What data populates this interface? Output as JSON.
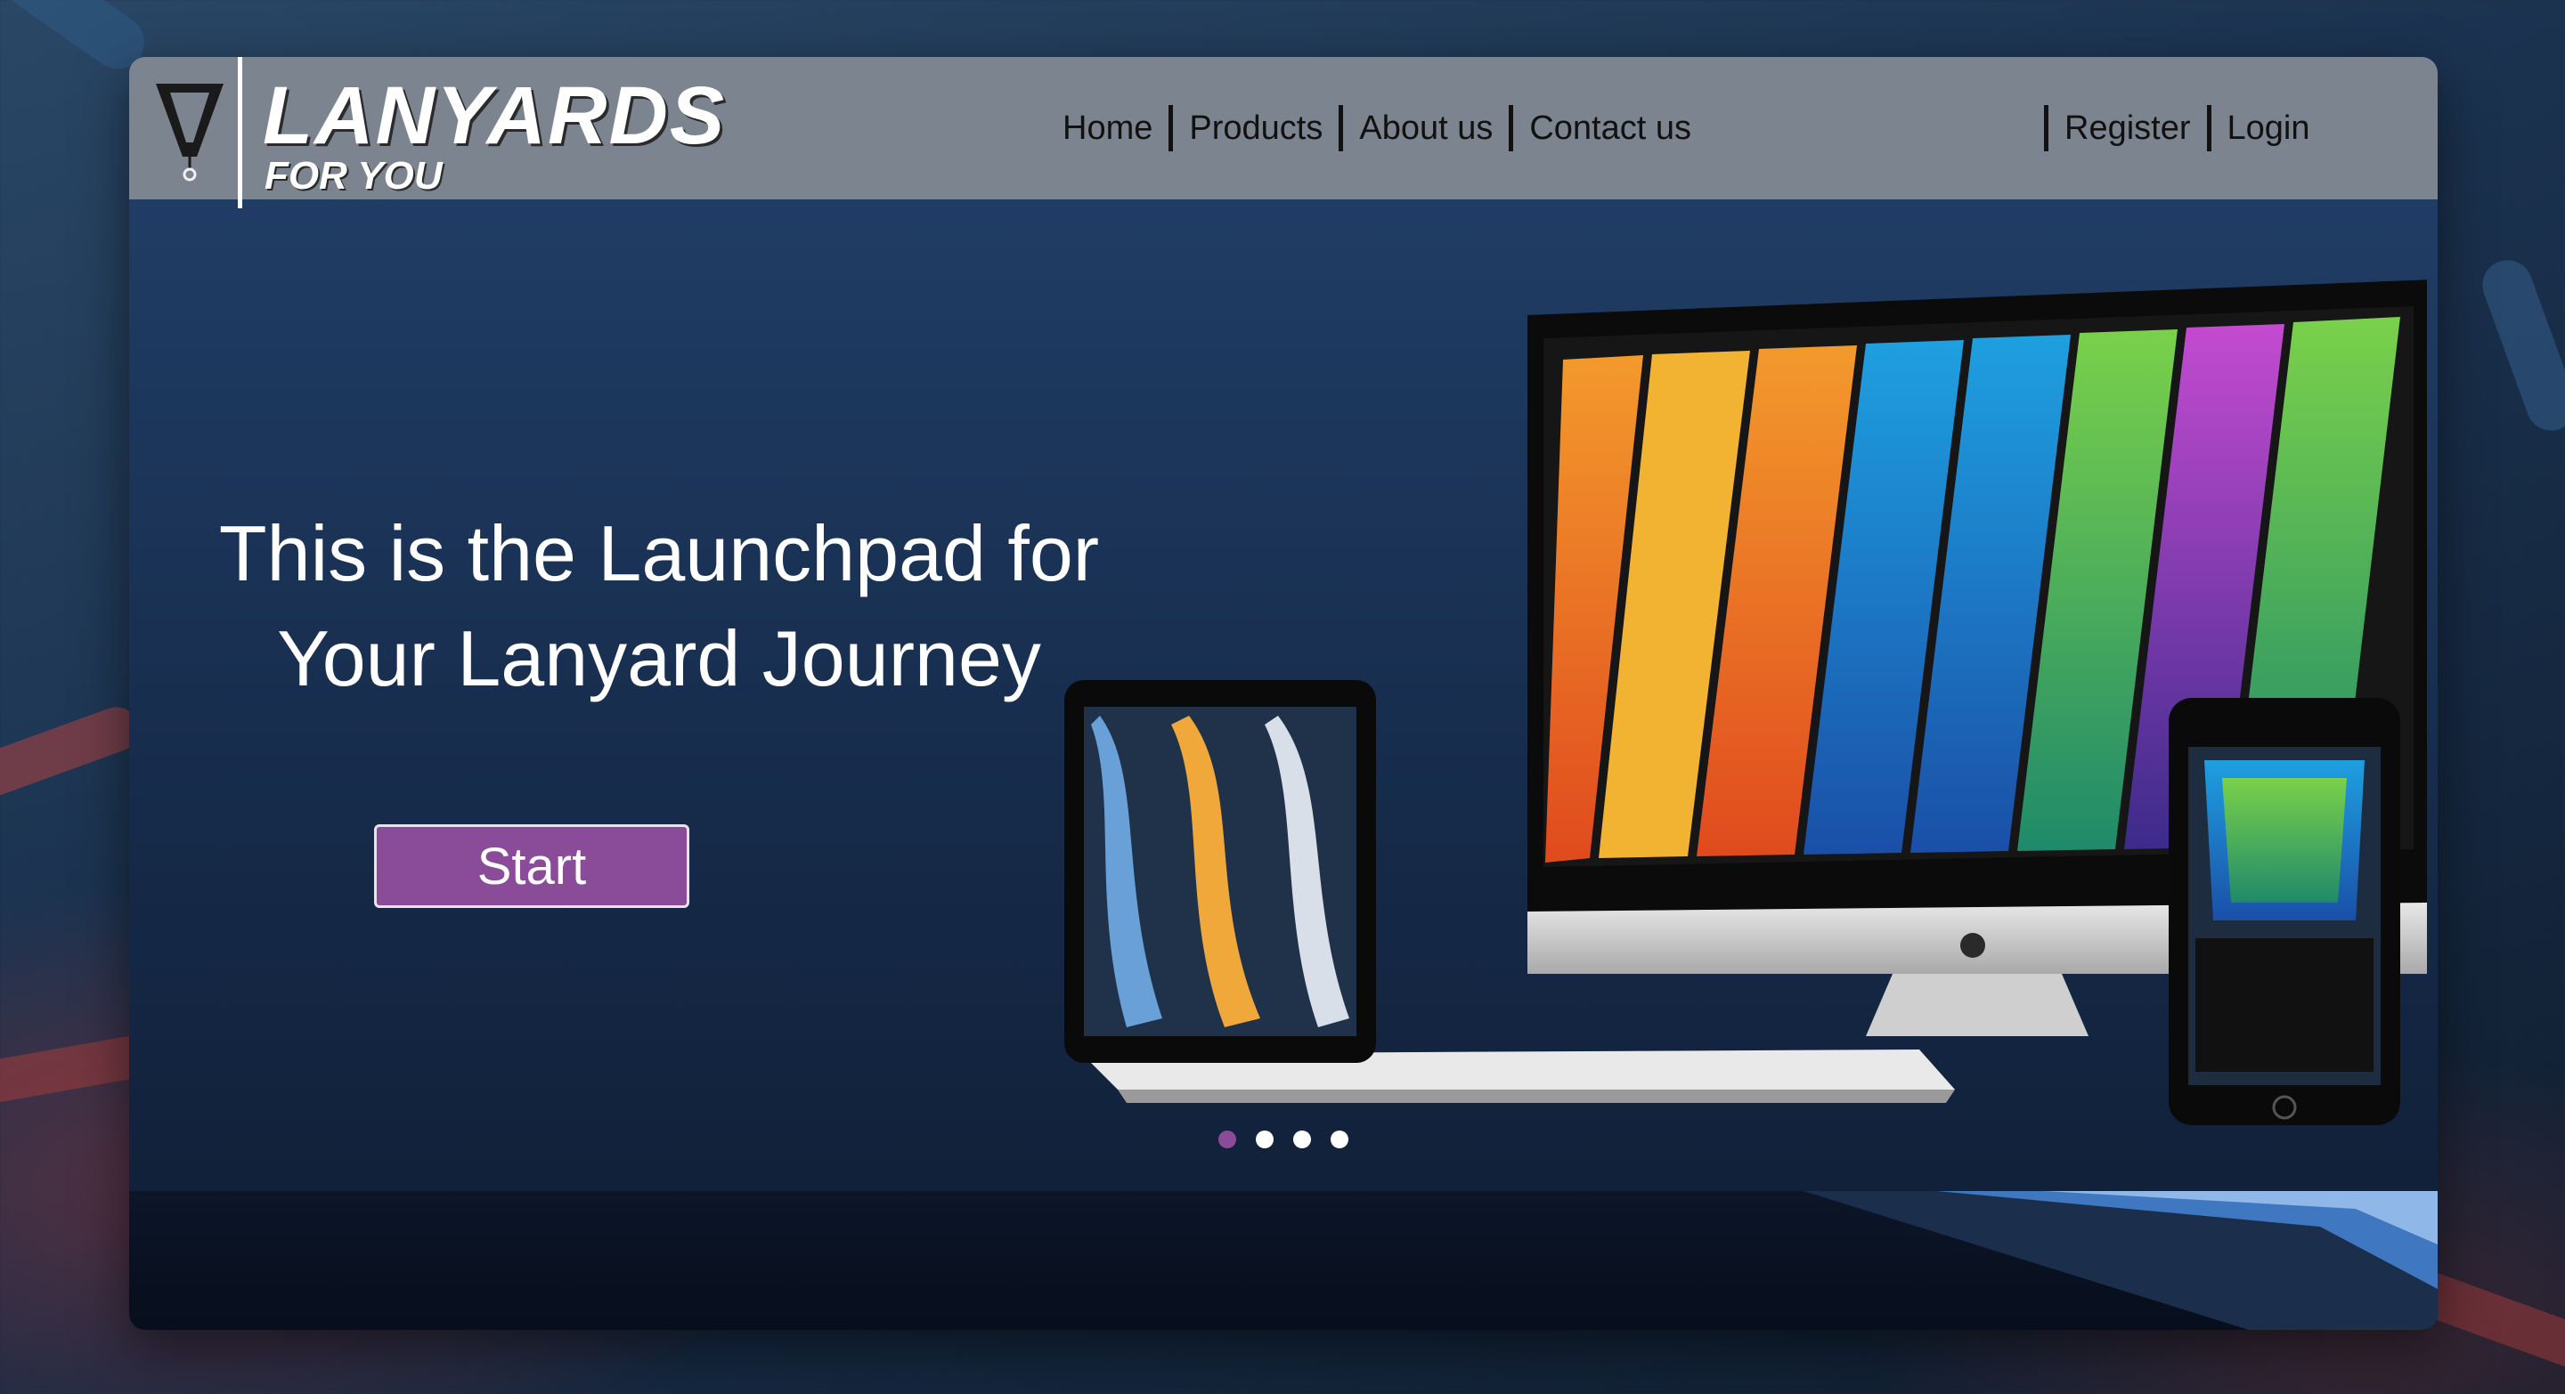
{
  "brand": {
    "title": "LANYARDS",
    "subtitle": "FOR YOU",
    "logo_icon": "lanyard-v-icon"
  },
  "nav": {
    "main_links": [
      {
        "label": "Home"
      },
      {
        "label": "Products"
      },
      {
        "label": "About us"
      },
      {
        "label": "Contact us"
      }
    ],
    "account_links": [
      {
        "label": "Register"
      },
      {
        "label": "Login"
      }
    ]
  },
  "hero": {
    "heading": "This is the Launchpad for Your Lanyard Journey",
    "start_label": "Start",
    "devices_image": "desktop-tablet-phone-lanyard-mockup"
  },
  "carousel": {
    "total_slides": 4,
    "active_slide": 1
  },
  "colors": {
    "navbar": "#7c858f",
    "accent": "#8a4b99",
    "background": "#1b3458"
  }
}
